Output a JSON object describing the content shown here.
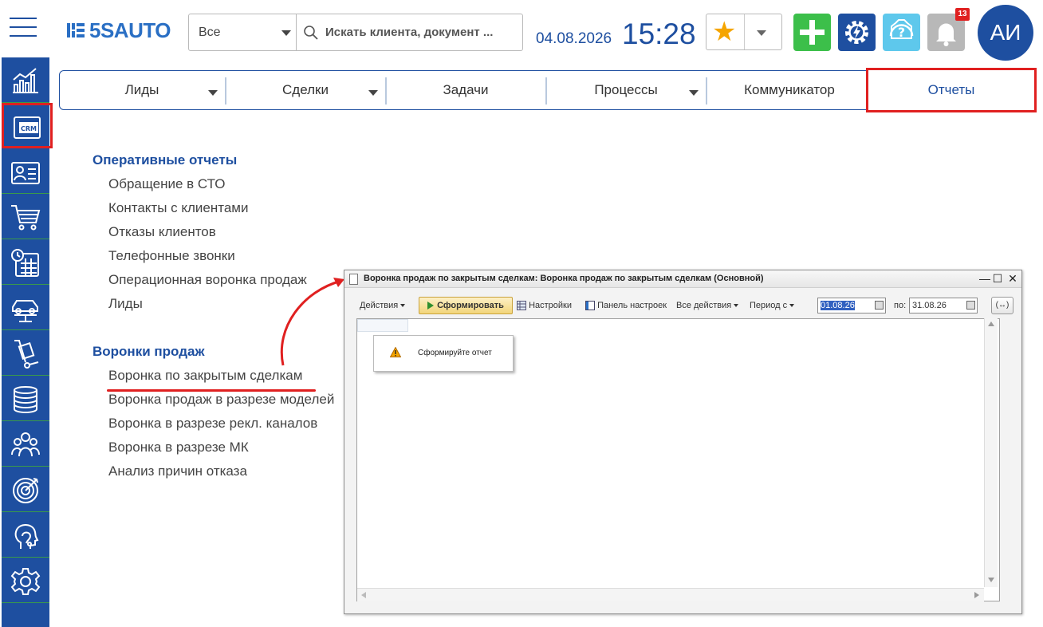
{
  "header": {
    "logo_text": "5SAUTO",
    "scope_select": "Все",
    "search_placeholder": "Искать клиента, документ ...",
    "date": "04.08.2026",
    "time": "15:28",
    "notifications_count": "13",
    "avatar_initials": "АИ"
  },
  "sidebar": {
    "items": [
      "chart-icon",
      "crm-icon",
      "contact-card-icon",
      "cart-icon",
      "calendar-icon",
      "car-lift-icon",
      "hand-truck-icon",
      "coins-stack-icon",
      "people-group-icon",
      "target-icon",
      "head-support-icon",
      "gear-icon"
    ],
    "crm_label": "CRM",
    "active_index": 1
  },
  "tabs": [
    {
      "label": "Лиды",
      "dropdown": true
    },
    {
      "label": "Сделки",
      "dropdown": true
    },
    {
      "label": "Задачи",
      "dropdown": false
    },
    {
      "label": "Процессы",
      "dropdown": true
    },
    {
      "label": "Коммуникатор",
      "dropdown": false
    },
    {
      "label": "Отчеты",
      "dropdown": false,
      "active": true
    }
  ],
  "reports": {
    "section1": {
      "title": "Оперативные отчеты",
      "items": [
        "Обращение в СТО",
        "Контакты с клиентами",
        "Отказы клиентов",
        "Телефонные звонки",
        "Операционная воронка продаж",
        "Лиды"
      ]
    },
    "section2": {
      "title": "Воронки продаж",
      "items": [
        "Воронка по закрытым сделкам",
        "Воронка продаж в разрезе моделей",
        "Воронка в разрезе рекл. каналов",
        "Воронка в разрезе МК",
        "Анализ причин отказа"
      ]
    }
  },
  "report_window": {
    "title": "Воронка продаж по закрытым сделкам: Воронка продаж по закрытым сделкам (Основной)",
    "toolbar": {
      "actions": "Действия",
      "generate": "Сформировать",
      "settings": "Настройки",
      "settings_panel": "Панель настроек",
      "all_actions": "Все действия",
      "period_from": "Период с",
      "date_from": "01.08.26",
      "to_label": "по:",
      "date_to": "31.08.26",
      "period_button": "(↔)"
    },
    "message": "Сформируйте отчет"
  },
  "colors": {
    "brand_blue": "#1e4fa0",
    "highlight_red": "#e02020",
    "add_green": "#3cbf4a",
    "help_cyan": "#5ec8ec",
    "star": "#f5a500"
  }
}
